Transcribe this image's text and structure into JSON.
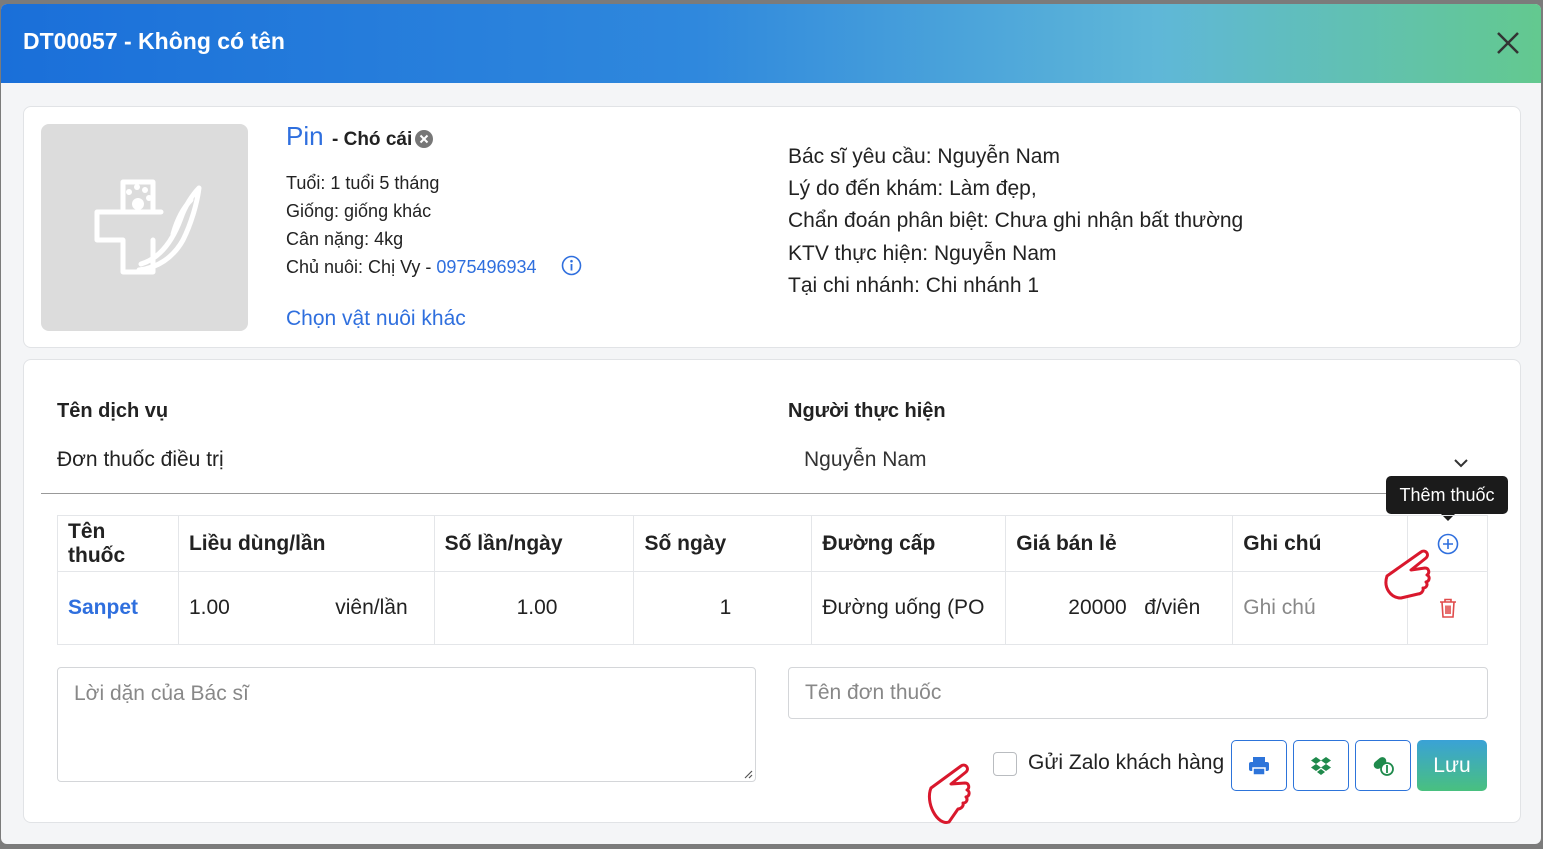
{
  "colors": {
    "accent": "#2f6fde",
    "danger": "#e04b4b"
  },
  "modal": {
    "title": "DT00057 - Không có tên",
    "close_icon": "close-icon"
  },
  "pet": {
    "name": "Pin",
    "gender": "- Chó cái",
    "age": "Tuổi: 1 tuổi 5 tháng",
    "breed": "Giống: giống khác",
    "weight": "Cân nặng: 4kg",
    "owner_label": "Chủ nuôi: Chị Vy - ",
    "owner_phone": "0975496934",
    "choose_other": "Chọn vật nuôi khác"
  },
  "exam": {
    "doctor": "Bác sĩ yêu cầu: Nguyễn Nam",
    "reason": "Lý do đến khám: Làm đẹp,",
    "diagnosis": "Chẩn đoán phân biệt: Chưa ghi nhận bất thường",
    "technician": "KTV thực hiện: Nguyễn Nam",
    "branch": "Tại chi nhánh: Chi nhánh 1"
  },
  "service": {
    "name_label": "Tên dịch vụ",
    "name_value": "Đơn thuốc điều trị",
    "performer_label": "Người thực hiện",
    "performer_value": "Nguyễn Nam"
  },
  "tooltip": "Thêm thuốc",
  "table": {
    "headers": [
      "Tên thuốc",
      "Liều dùng/lần",
      "Số lần/ngày",
      "Số ngày",
      "Đường cấp",
      "Giá bán lẻ",
      "Ghi chú"
    ],
    "row": {
      "drug": "Sanpet",
      "dose": "1.00",
      "dose_unit": "viên/lần",
      "times": "1.00",
      "days": "1",
      "route": "Đường uống (PO",
      "price": "20000",
      "price_unit": "đ/viên",
      "note_placeholder": "Ghi chú"
    }
  },
  "doctor_advice_placeholder": "Lời dặn của Bác sĩ",
  "prescription_name_placeholder": "Tên đơn thuốc",
  "send_zalo_label": "Gửi Zalo khách hàng",
  "save_label": "Lưu"
}
